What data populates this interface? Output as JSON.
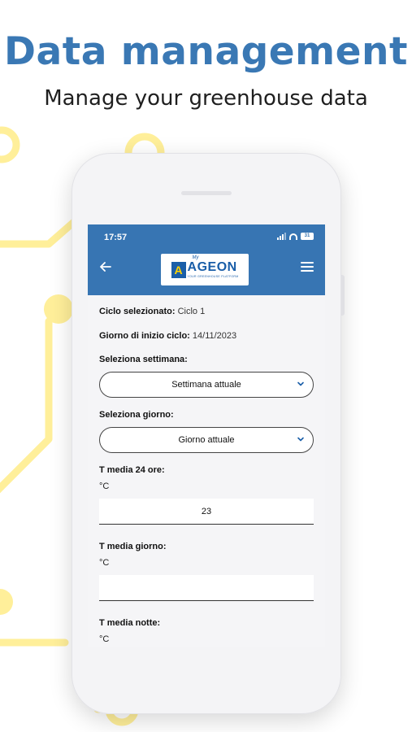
{
  "promo": {
    "title": "Data management",
    "subtitle": "Manage your greenhouse data"
  },
  "colors": {
    "brand_blue": "#3775b3",
    "headline_blue": "#3a78b4",
    "circuit_yellow": "#ffef9a"
  },
  "status_bar": {
    "time": "17:57",
    "battery": "31"
  },
  "app_bar": {
    "back_icon": "arrow-left-icon",
    "menu_icon": "hamburger-menu-icon",
    "logo": {
      "mark": "A",
      "prefix": "My",
      "name": "AGEON",
      "tagline": "YOUR GREENHOUSE PLATFORM"
    }
  },
  "cycle": {
    "selected_label": "Ciclo selezionato:",
    "selected_value": "Ciclo 1",
    "start_label": "Giorno di inizio ciclo:",
    "start_value": "14/11/2023"
  },
  "week_select": {
    "label": "Seleziona settimana:",
    "value": "Settimana attuale"
  },
  "day_select": {
    "label": "Seleziona giorno:",
    "value": "Giorno attuale"
  },
  "fields": [
    {
      "label": "T media 24 ore:",
      "unit": "°C",
      "value": "23"
    },
    {
      "label": "T media giorno:",
      "unit": "°C",
      "value": ""
    },
    {
      "label": "T media notte:",
      "unit": "°C",
      "value": ""
    }
  ]
}
